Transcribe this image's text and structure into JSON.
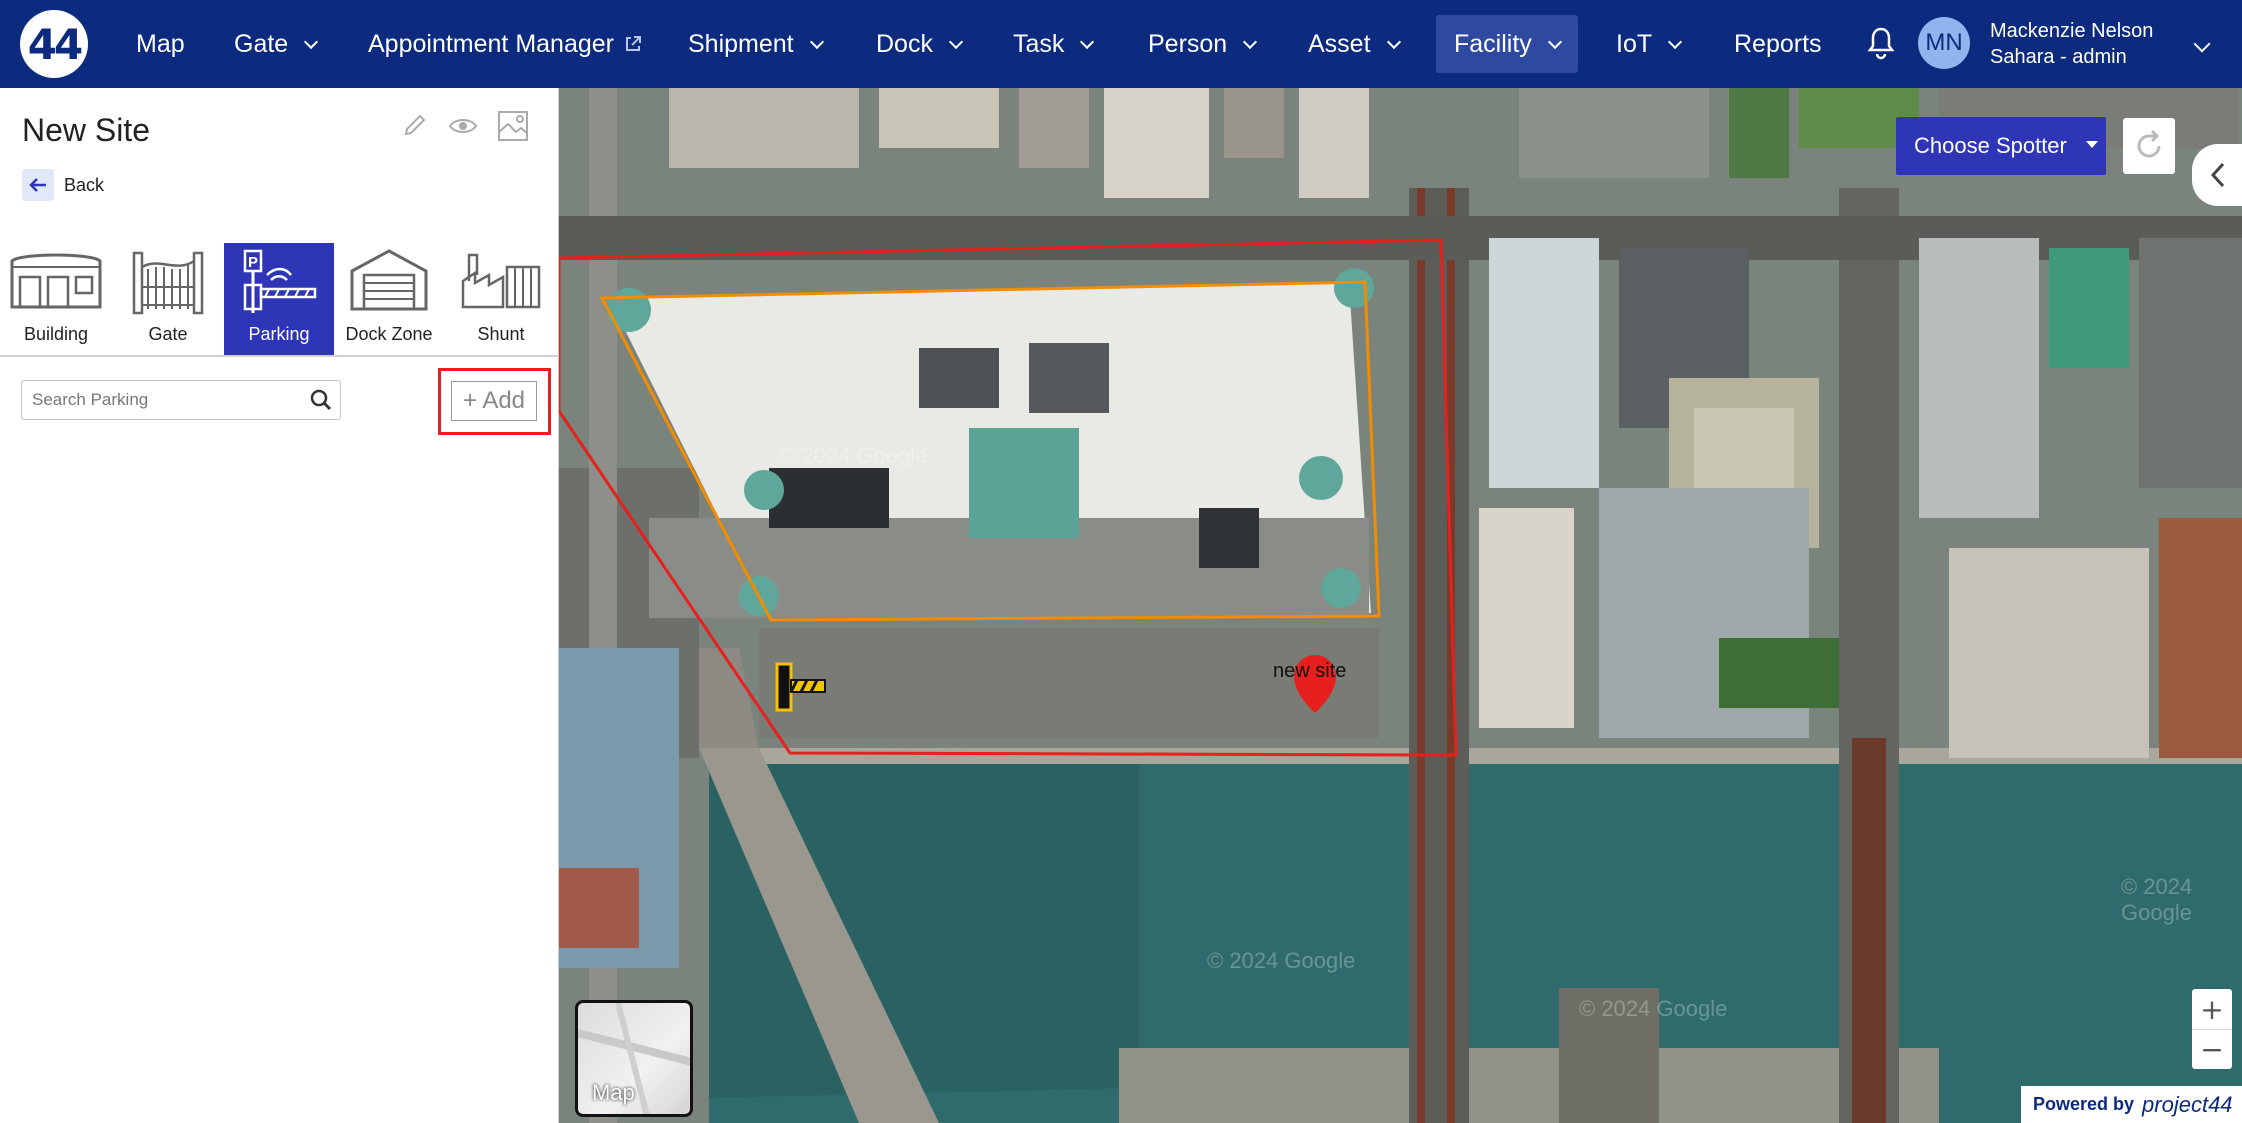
{
  "nav": {
    "logo": "44",
    "items": [
      {
        "label": "Map"
      },
      {
        "label": "Gate"
      },
      {
        "label": "Appointment Manager"
      },
      {
        "label": "Shipment"
      },
      {
        "label": "Dock"
      },
      {
        "label": "Task"
      },
      {
        "label": "Person"
      },
      {
        "label": "Asset"
      },
      {
        "label": "Facility"
      },
      {
        "label": "IoT"
      },
      {
        "label": "Reports"
      }
    ],
    "active": "Facility",
    "user": {
      "initials": "MN",
      "name": "Mackenzie Nelson",
      "role": "Sahara - admin"
    }
  },
  "panel": {
    "title": "New Site",
    "back_label": "Back",
    "tiles": [
      {
        "label": "Building",
        "icon": "building-icon"
      },
      {
        "label": "Gate",
        "icon": "gate-icon"
      },
      {
        "label": "Parking",
        "icon": "parking-icon"
      },
      {
        "label": "Dock Zone",
        "icon": "dock-zone-icon"
      },
      {
        "label": "Shunt",
        "icon": "shunt-icon"
      }
    ],
    "active_tile": "Parking",
    "search": {
      "placeholder": "Search Parking",
      "value": ""
    },
    "add_label": "+ Add"
  },
  "map": {
    "spotter_label": "Choose Spotter",
    "marker_label": "new site",
    "map_type_label": "Map",
    "copyright": "© 2024 Google",
    "powered_by": "Powered by",
    "powered_brand": "project44",
    "zoom_in": "+",
    "zoom_out": "−"
  },
  "colors": {
    "nav_bg": "#0d2b7e",
    "active_tile": "#2e35b7",
    "site_boundary": "#e5201f",
    "building_outline": "#f28c00",
    "highlight": "#e5201f"
  }
}
